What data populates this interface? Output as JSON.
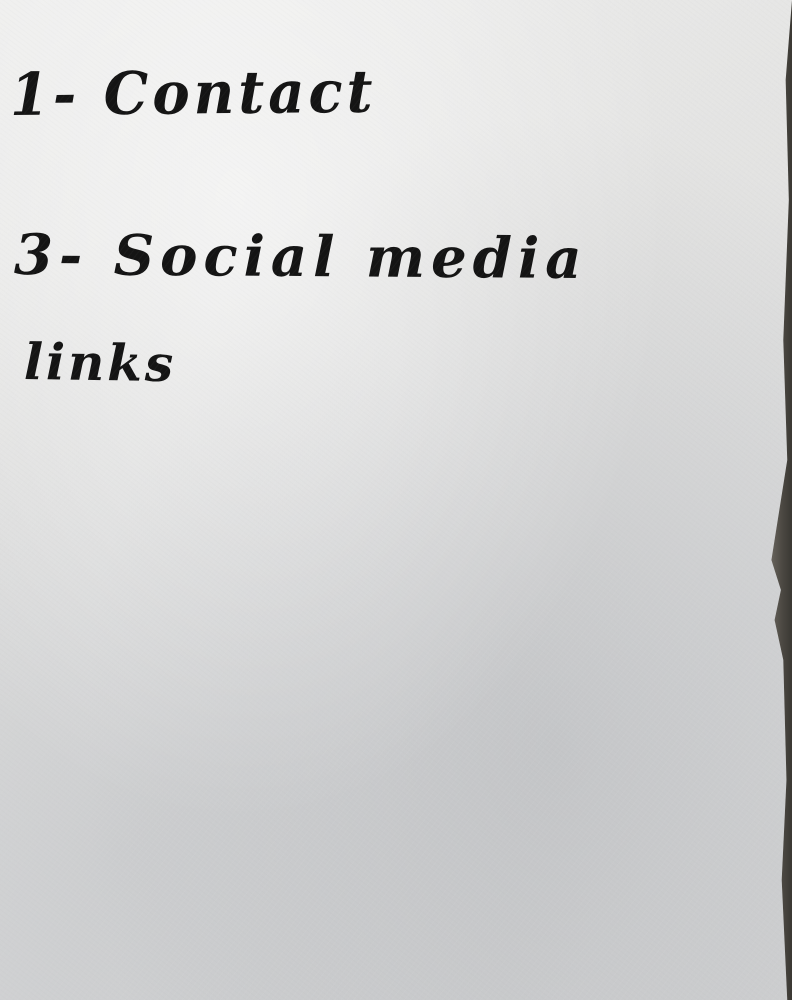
{
  "note": {
    "lines": [
      "1- Contact",
      "3- Social media",
      "links"
    ]
  }
}
